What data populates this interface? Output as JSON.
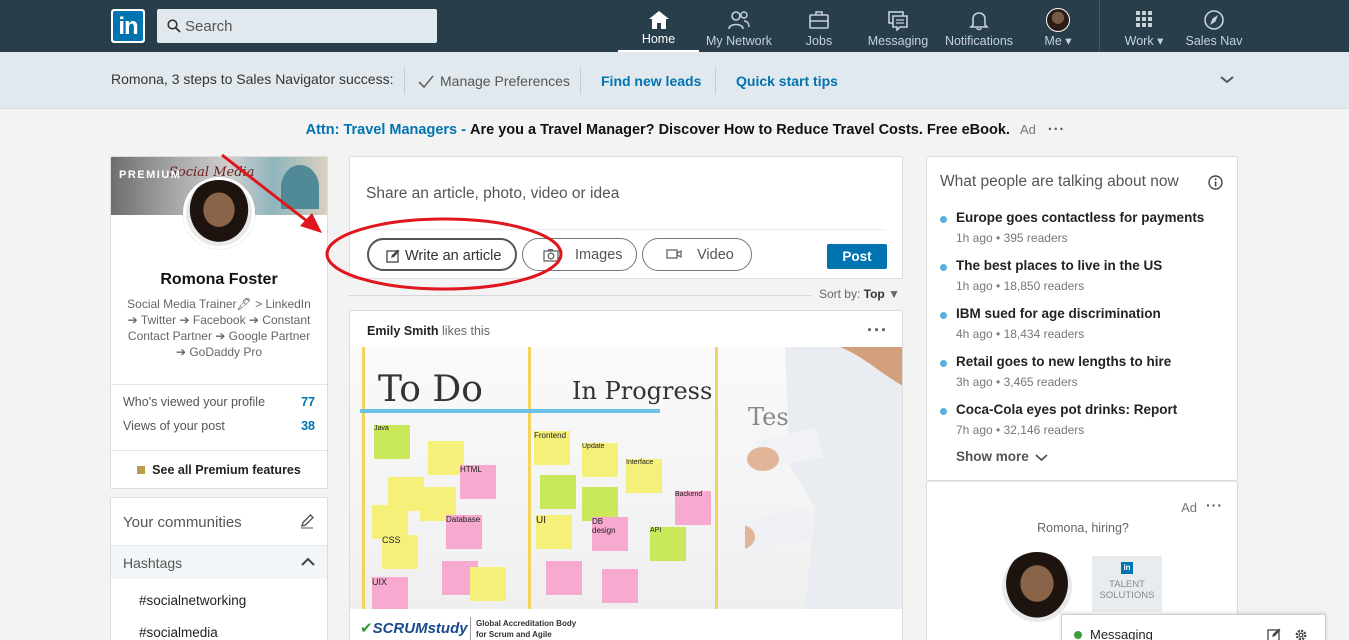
{
  "nav": {
    "logo": "in",
    "search_placeholder": "Search",
    "items": [
      {
        "label": "Home",
        "icon": "home-icon",
        "active": true
      },
      {
        "label": "My Network",
        "icon": "network-icon"
      },
      {
        "label": "Jobs",
        "icon": "briefcase-icon"
      },
      {
        "label": "Messaging",
        "icon": "messaging-icon"
      },
      {
        "label": "Notifications",
        "icon": "bell-icon"
      },
      {
        "label": "Me",
        "icon": "avatar"
      },
      {
        "label": "Work",
        "icon": "grid-icon"
      },
      {
        "label": "Sales Nav",
        "icon": "compass-icon"
      }
    ]
  },
  "sales_nav_bar": {
    "intro": "Romona, 3 steps to Sales Navigator success:",
    "manage": "Manage Preferences",
    "find_leads": "Find new leads",
    "quick_tips": "Quick start tips"
  },
  "ad_line": {
    "attn": "Attn: Travel Managers -",
    "message": "Are you a Travel Manager? Discover How to Reduce Travel Costs. Free eBook.",
    "ad": "Ad",
    "dots": "···"
  },
  "profile": {
    "premium": "PREMIUM",
    "banner_text": "Social Media",
    "name": "Romona Foster",
    "headline": "Social Media Trainer🖋 > LinkedIn ➔ Twitter ➔ Facebook ➔ Constant Contact Partner ➔ Google Partner ➔ GoDaddy Pro",
    "stats": [
      {
        "label": "Who's viewed your profile",
        "value": "77"
      },
      {
        "label": "Views of your post",
        "value": "38"
      }
    ],
    "see_all": "See all Premium features"
  },
  "communities": {
    "title": "Your communities",
    "hashtags_label": "Hashtags",
    "tags": [
      "#socialnetworking",
      "#socialmedia"
    ]
  },
  "share": {
    "prompt": "Share an article, photo, video or idea",
    "write_article": "Write an article",
    "images": "Images",
    "video": "Video",
    "post": "Post"
  },
  "sort": {
    "label": "Sort by:",
    "value": "Top"
  },
  "feed_post": {
    "actor": "Emily Smith",
    "action": "likes this",
    "board_columns": [
      "To Do",
      "In Progress",
      "Testing"
    ],
    "notes": [
      "Java",
      "Database",
      "HTML",
      "Frontend",
      "Update",
      "Interface",
      "CSS",
      "UI",
      "DB design",
      "UIX",
      "Backend",
      "API"
    ],
    "logo_name": "SCRUMstudy",
    "logo_tagline": "Global Accreditation Body for Scrum and Agile Certifications"
  },
  "news": {
    "title": "What people are talking about now",
    "items": [
      {
        "title": "Europe goes contactless for payments",
        "meta": "1h ago • 395 readers"
      },
      {
        "title": "The best places to live in the US",
        "meta": "1h ago • 18,850 readers"
      },
      {
        "title": "IBM sued for age discrimination",
        "meta": "4h ago • 18,434 readers"
      },
      {
        "title": "Retail goes to new lengths to hire",
        "meta": "3h ago • 3,465 readers"
      },
      {
        "title": "Coca-Cola eyes pot drinks: Report",
        "meta": "7h ago • 32,146 readers"
      }
    ],
    "show_more": "Show more"
  },
  "ad_card": {
    "ad": "Ad",
    "dots": "···",
    "hiring": "Romona, hiring?",
    "talent": "TALENT SOLUTIONS",
    "talent_logo": "in"
  },
  "messaging_bar": {
    "label": "Messaging"
  },
  "colors": {
    "nav_bg": "#283e4a",
    "link_blue": "#0073b1",
    "annotation_red": "#e0161e",
    "online_green": "#3a9c3a"
  }
}
